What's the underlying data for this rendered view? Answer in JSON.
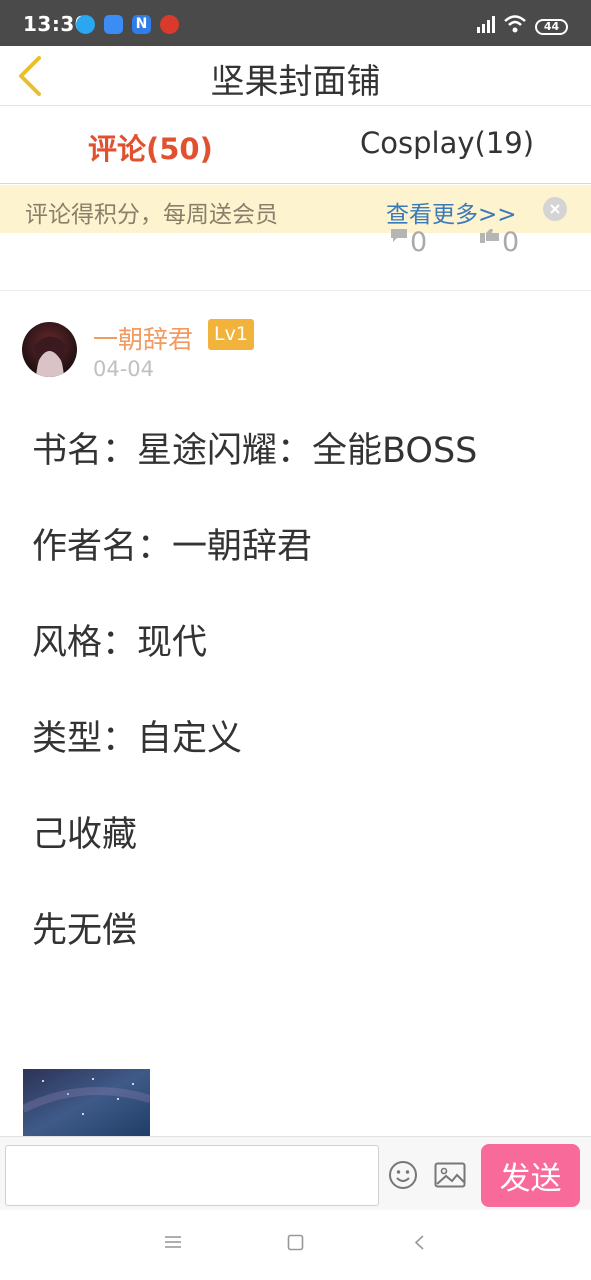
{
  "status_bar": {
    "time": "13:30",
    "notification_letter": "N",
    "battery": "44"
  },
  "header": {
    "title": "坚果封面铺"
  },
  "tabs": [
    {
      "label": "评论(50)",
      "active": true
    },
    {
      "label": "Cosplay(19)",
      "active": false
    }
  ],
  "banner": {
    "text": "评论得积分，每周送会员",
    "link": "查看更多>>"
  },
  "prev_post": {
    "comment_count": "0",
    "like_count": "0"
  },
  "comment": {
    "username": "一朝辞君",
    "level": "Lv1",
    "date": "04-04",
    "lines": [
      "书名：星途闪耀：全能BOSS",
      "作者名：一朝辞君",
      "风格：现代",
      "类型：自定义",
      "己收藏",
      "先无偿"
    ]
  },
  "input_bar": {
    "placeholder": "",
    "send_label": "发送"
  },
  "colors": {
    "accent_red": "#e1502f",
    "username_orange": "#f29a5f",
    "level_badge": "#f2b33c",
    "send_pink": "#f76a9a",
    "banner_bg": "#fdf4cf",
    "link_blue": "#3a7ab8"
  },
  "icons": [
    "back-chevron-icon",
    "comment-icon",
    "like-icon",
    "emoji-icon",
    "image-icon",
    "close-icon",
    "menu-icon",
    "home-icon",
    "nav-back-icon"
  ]
}
